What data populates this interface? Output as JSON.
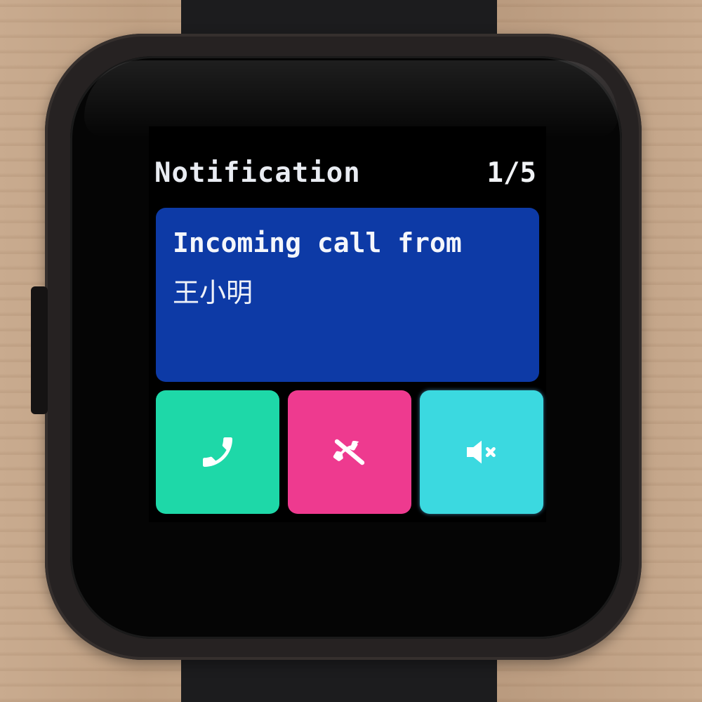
{
  "notification": {
    "title": "Notification",
    "counter": "1/5",
    "message": "Incoming call from",
    "caller": "王小明"
  },
  "actions": [
    {
      "name": "accept-call",
      "icon": "phone-icon",
      "color": "#1ed8a8"
    },
    {
      "name": "reject-call",
      "icon": "phone-off-icon",
      "color": "#ee3a8f"
    },
    {
      "name": "mute",
      "icon": "speaker-mute-icon",
      "color": "#3bd9e0"
    }
  ],
  "colors": {
    "card": "#0d3aa6",
    "screen_bg": "#000000"
  }
}
